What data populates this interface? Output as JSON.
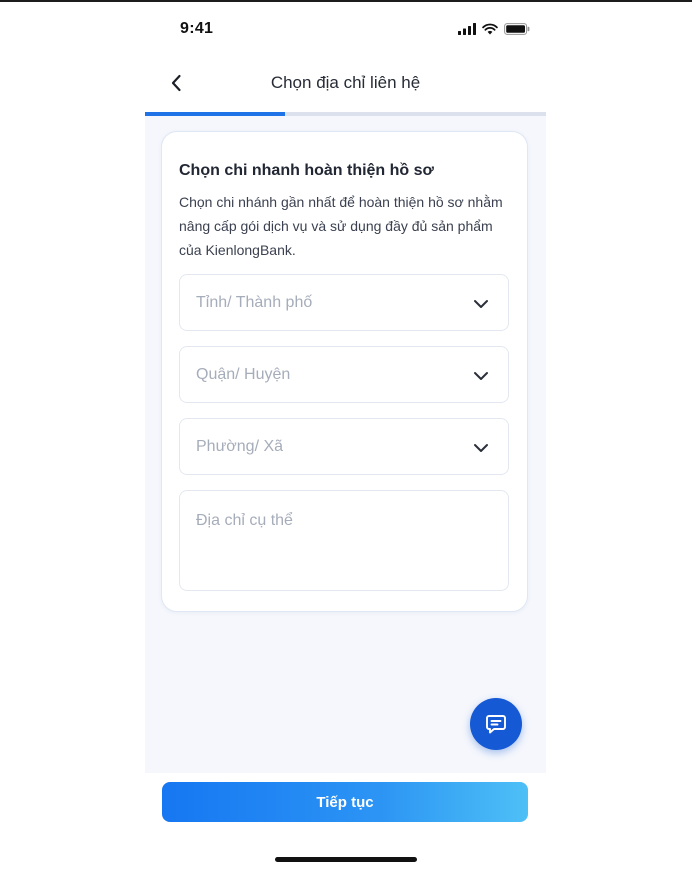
{
  "status_bar": {
    "time": "9:41",
    "icons": [
      "cellular-signal-icon",
      "wifi-icon",
      "battery-icon"
    ]
  },
  "header": {
    "back_icon": "chevron-left-icon",
    "title": "Chọn địa chỉ liên hệ"
  },
  "progress": {
    "fraction": 0.35
  },
  "card": {
    "title": "Chọn chi nhanh hoàn thiện hồ sơ",
    "description": "Chọn chi nhánh gần nhất để hoàn thiện hồ sơ nhằm nâng cấp gói dịch vụ và sử dụng đầy đủ sản phẩm của KienlongBank."
  },
  "form": {
    "province_placeholder": "Tỉnh/ Thành phố",
    "district_placeholder": "Quận/ Huyện",
    "ward_placeholder": "Phường/ Xã",
    "address_placeholder": "Địa chỉ cụ thể"
  },
  "chat_button": {
    "icon": "chat-icon"
  },
  "footer": {
    "continue_label": "Tiếp tục"
  },
  "colors": {
    "accent": "#1f73e6",
    "fab": "#1559d4",
    "placeholder": "#a6adba",
    "background": "#f5f7fc"
  }
}
